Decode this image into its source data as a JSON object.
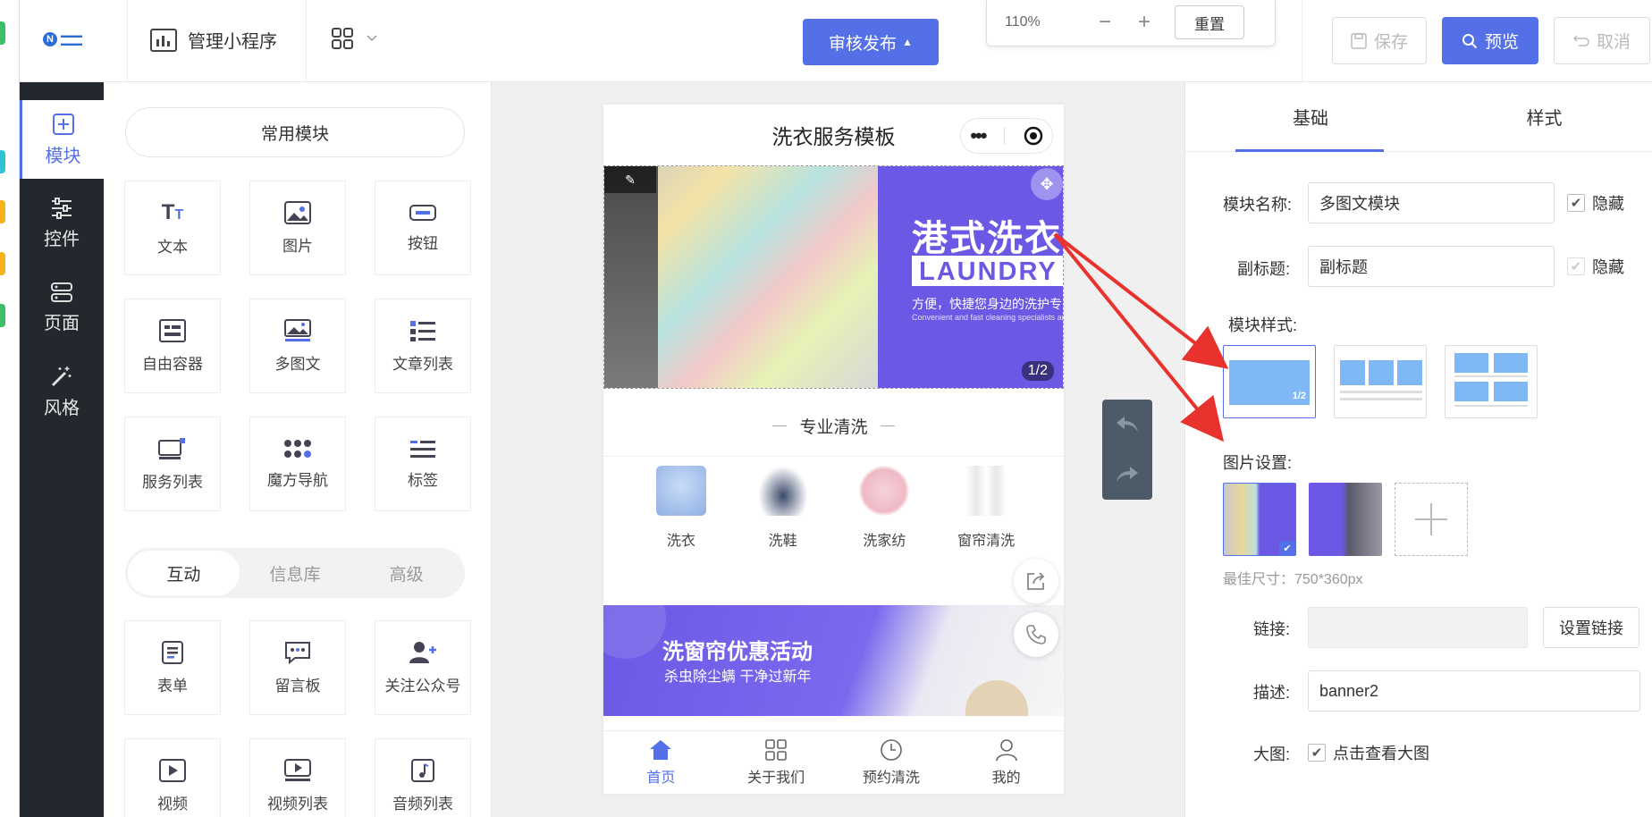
{
  "topbar": {
    "logo_text": "N",
    "manage_label": "管理小程序",
    "publish_label": "审核发布",
    "zoom": {
      "value": "110%",
      "minus": "−",
      "plus": "+",
      "reset": "重置"
    },
    "save_label": "保存",
    "preview_label": "预览",
    "cancel_label": "取消"
  },
  "sidenav": {
    "items": [
      {
        "label": "模块",
        "icon": "plus-square-icon"
      },
      {
        "label": "控件",
        "icon": "sliders-icon"
      },
      {
        "label": "页面",
        "icon": "pages-icon"
      },
      {
        "label": "风格",
        "icon": "magic-wand-icon"
      }
    ]
  },
  "modules": {
    "section_title": "常用模块",
    "common": [
      {
        "label": "文本",
        "icon": "text-icon"
      },
      {
        "label": "图片",
        "icon": "image-icon"
      },
      {
        "label": "按钮",
        "icon": "button-icon"
      },
      {
        "label": "自由容器",
        "icon": "container-icon"
      },
      {
        "label": "多图文",
        "icon": "multi-image-text-icon"
      },
      {
        "label": "文章列表",
        "icon": "article-list-icon"
      },
      {
        "label": "服务列表",
        "icon": "service-list-icon"
      },
      {
        "label": "魔方导航",
        "icon": "grid-nav-icon"
      },
      {
        "label": "标签",
        "icon": "tag-icon"
      }
    ],
    "tabs": [
      "互动",
      "信息库",
      "高级"
    ],
    "interactive": [
      {
        "label": "表单",
        "icon": "form-icon"
      },
      {
        "label": "留言板",
        "icon": "message-board-icon"
      },
      {
        "label": "关注公众号",
        "icon": "follow-account-icon"
      },
      {
        "label": "视频",
        "icon": "video-icon"
      },
      {
        "label": "视频列表",
        "icon": "video-list-icon"
      },
      {
        "label": "音频列表",
        "icon": "audio-list-icon"
      }
    ]
  },
  "phone": {
    "title": "洗衣服务模板",
    "banner": {
      "title": "港式洗衣",
      "laundry": "LAUNDRY",
      "sub": "方便，快捷您身边的洗护专家",
      "sub_en": "Convenient and fast cleaning specialists around",
      "page": "1/2"
    },
    "section_title": "专业清洗",
    "services": [
      {
        "label": "洗衣",
        "color": "#a9c6ef"
      },
      {
        "label": "洗鞋",
        "color": "#2e3d5c"
      },
      {
        "label": "洗家纺",
        "color": "#f2c4cd"
      },
      {
        "label": "窗帘清洗",
        "color": "#e6e6e6"
      }
    ],
    "promo": {
      "title": "洗窗帘优惠活动",
      "sub": "杀虫除尘螨 干净过新年"
    },
    "tabbar": [
      {
        "label": "首页",
        "icon": "home-icon"
      },
      {
        "label": "关于我们",
        "icon": "grid-icon"
      },
      {
        "label": "预约清洗",
        "icon": "clock-icon"
      },
      {
        "label": "我的",
        "icon": "user-icon"
      }
    ]
  },
  "panel": {
    "tabs": [
      "基础",
      "样式"
    ],
    "module_name_label": "模块名称:",
    "module_name_value": "多图文模块",
    "hide_label": "隐藏",
    "subtitle_label": "副标题:",
    "subtitle_value": "副标题",
    "style_label": "模块样式:",
    "style_page": "1/2",
    "image_label": "图片设置:",
    "image_hint": "最佳尺寸：750*360px",
    "link_label": "链接:",
    "link_value": "",
    "set_link_label": "设置链接",
    "desc_label": "描述:",
    "desc_value": "banner2",
    "bigimg_label": "大图:",
    "bigimg_check_label": "点击查看大图"
  },
  "colors": {
    "accent": "#5470e6",
    "banner_purple": "#6b59e6",
    "sidenav": "#23272e",
    "arrow": "#e8322e"
  }
}
